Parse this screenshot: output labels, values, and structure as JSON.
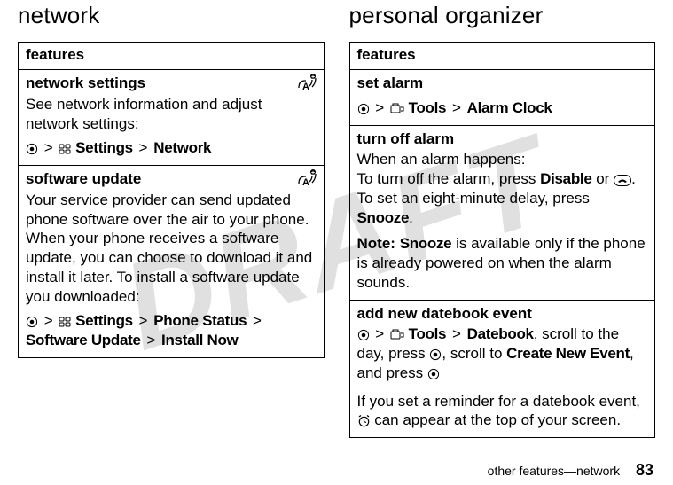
{
  "watermark": "DRAFT",
  "left": {
    "heading": "network",
    "table_header": "features",
    "rows": [
      {
        "title": "network settings",
        "desc": "See network information and adjust network settings:",
        "path_parts": {
          "p1": "Settings",
          "p2": "Network"
        },
        "has_corner_icon": true
      },
      {
        "title": "software update",
        "desc": "Your service provider can send updated phone software over the air to your phone. When your phone receives a software update, you can choose to download it and install it later. To install a software update you downloaded:",
        "path_parts": {
          "p1": "Settings",
          "p2": "Phone Status",
          "p3": "Software Update",
          "p4": "Install Now"
        },
        "has_corner_icon": true
      }
    ]
  },
  "right": {
    "heading": "personal organizer",
    "table_header": "features",
    "rows": [
      {
        "title": "set alarm",
        "path_parts": {
          "p1": "Tools",
          "p2": "Alarm Clock"
        }
      },
      {
        "title": "turn off alarm",
        "line1": "When an alarm happens:",
        "line2a": "To turn off the alarm, press ",
        "line2b": "Disable",
        "line2c": " or ",
        "line2d": ".",
        "line3a": "To set an eight-minute delay, press ",
        "line3b": "Snooze",
        "line3c": ".",
        "note_label": "Note:",
        "note_a": " ",
        "note_b": "Snooze",
        "note_c": " is available only if the phone is already powered on when the alarm sounds."
      },
      {
        "title": "add new datebook event",
        "path_parts": {
          "p1": "Tools",
          "p2": "Datebook"
        },
        "after_path_a": ", scroll to the day, press ",
        "after_path_b": ", scroll to ",
        "after_path_c": "Create New Event",
        "after_path_d": ", and press ",
        "tail": "If you set a reminder for a datebook event, ",
        "tail2": " can appear at the top of your screen."
      }
    ]
  },
  "footer": {
    "text": "other features—network",
    "page": "83"
  }
}
